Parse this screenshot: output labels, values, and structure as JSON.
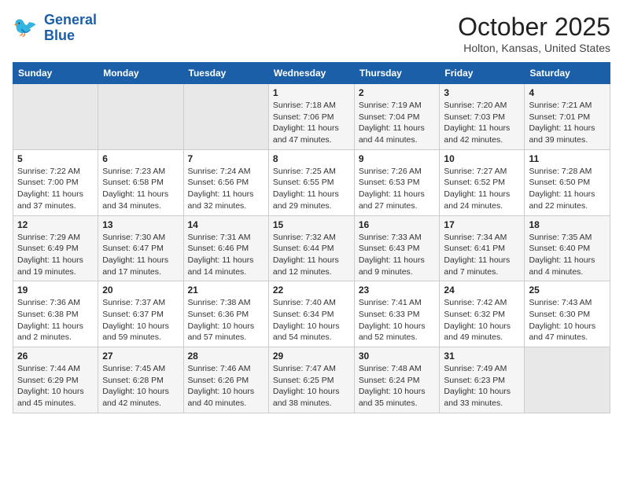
{
  "header": {
    "logo_line1": "General",
    "logo_line2": "Blue",
    "month": "October 2025",
    "location": "Holton, Kansas, United States"
  },
  "days_of_week": [
    "Sunday",
    "Monday",
    "Tuesday",
    "Wednesday",
    "Thursday",
    "Friday",
    "Saturday"
  ],
  "weeks": [
    [
      {
        "day": "",
        "sunrise": "",
        "sunset": "",
        "daylight": ""
      },
      {
        "day": "",
        "sunrise": "",
        "sunset": "",
        "daylight": ""
      },
      {
        "day": "",
        "sunrise": "",
        "sunset": "",
        "daylight": ""
      },
      {
        "day": "1",
        "sunrise": "Sunrise: 7:18 AM",
        "sunset": "Sunset: 7:06 PM",
        "daylight": "Daylight: 11 hours and 47 minutes."
      },
      {
        "day": "2",
        "sunrise": "Sunrise: 7:19 AM",
        "sunset": "Sunset: 7:04 PM",
        "daylight": "Daylight: 11 hours and 44 minutes."
      },
      {
        "day": "3",
        "sunrise": "Sunrise: 7:20 AM",
        "sunset": "Sunset: 7:03 PM",
        "daylight": "Daylight: 11 hours and 42 minutes."
      },
      {
        "day": "4",
        "sunrise": "Sunrise: 7:21 AM",
        "sunset": "Sunset: 7:01 PM",
        "daylight": "Daylight: 11 hours and 39 minutes."
      }
    ],
    [
      {
        "day": "5",
        "sunrise": "Sunrise: 7:22 AM",
        "sunset": "Sunset: 7:00 PM",
        "daylight": "Daylight: 11 hours and 37 minutes."
      },
      {
        "day": "6",
        "sunrise": "Sunrise: 7:23 AM",
        "sunset": "Sunset: 6:58 PM",
        "daylight": "Daylight: 11 hours and 34 minutes."
      },
      {
        "day": "7",
        "sunrise": "Sunrise: 7:24 AM",
        "sunset": "Sunset: 6:56 PM",
        "daylight": "Daylight: 11 hours and 32 minutes."
      },
      {
        "day": "8",
        "sunrise": "Sunrise: 7:25 AM",
        "sunset": "Sunset: 6:55 PM",
        "daylight": "Daylight: 11 hours and 29 minutes."
      },
      {
        "day": "9",
        "sunrise": "Sunrise: 7:26 AM",
        "sunset": "Sunset: 6:53 PM",
        "daylight": "Daylight: 11 hours and 27 minutes."
      },
      {
        "day": "10",
        "sunrise": "Sunrise: 7:27 AM",
        "sunset": "Sunset: 6:52 PM",
        "daylight": "Daylight: 11 hours and 24 minutes."
      },
      {
        "day": "11",
        "sunrise": "Sunrise: 7:28 AM",
        "sunset": "Sunset: 6:50 PM",
        "daylight": "Daylight: 11 hours and 22 minutes."
      }
    ],
    [
      {
        "day": "12",
        "sunrise": "Sunrise: 7:29 AM",
        "sunset": "Sunset: 6:49 PM",
        "daylight": "Daylight: 11 hours and 19 minutes."
      },
      {
        "day": "13",
        "sunrise": "Sunrise: 7:30 AM",
        "sunset": "Sunset: 6:47 PM",
        "daylight": "Daylight: 11 hours and 17 minutes."
      },
      {
        "day": "14",
        "sunrise": "Sunrise: 7:31 AM",
        "sunset": "Sunset: 6:46 PM",
        "daylight": "Daylight: 11 hours and 14 minutes."
      },
      {
        "day": "15",
        "sunrise": "Sunrise: 7:32 AM",
        "sunset": "Sunset: 6:44 PM",
        "daylight": "Daylight: 11 hours and 12 minutes."
      },
      {
        "day": "16",
        "sunrise": "Sunrise: 7:33 AM",
        "sunset": "Sunset: 6:43 PM",
        "daylight": "Daylight: 11 hours and 9 minutes."
      },
      {
        "day": "17",
        "sunrise": "Sunrise: 7:34 AM",
        "sunset": "Sunset: 6:41 PM",
        "daylight": "Daylight: 11 hours and 7 minutes."
      },
      {
        "day": "18",
        "sunrise": "Sunrise: 7:35 AM",
        "sunset": "Sunset: 6:40 PM",
        "daylight": "Daylight: 11 hours and 4 minutes."
      }
    ],
    [
      {
        "day": "19",
        "sunrise": "Sunrise: 7:36 AM",
        "sunset": "Sunset: 6:38 PM",
        "daylight": "Daylight: 11 hours and 2 minutes."
      },
      {
        "day": "20",
        "sunrise": "Sunrise: 7:37 AM",
        "sunset": "Sunset: 6:37 PM",
        "daylight": "Daylight: 10 hours and 59 minutes."
      },
      {
        "day": "21",
        "sunrise": "Sunrise: 7:38 AM",
        "sunset": "Sunset: 6:36 PM",
        "daylight": "Daylight: 10 hours and 57 minutes."
      },
      {
        "day": "22",
        "sunrise": "Sunrise: 7:40 AM",
        "sunset": "Sunset: 6:34 PM",
        "daylight": "Daylight: 10 hours and 54 minutes."
      },
      {
        "day": "23",
        "sunrise": "Sunrise: 7:41 AM",
        "sunset": "Sunset: 6:33 PM",
        "daylight": "Daylight: 10 hours and 52 minutes."
      },
      {
        "day": "24",
        "sunrise": "Sunrise: 7:42 AM",
        "sunset": "Sunset: 6:32 PM",
        "daylight": "Daylight: 10 hours and 49 minutes."
      },
      {
        "day": "25",
        "sunrise": "Sunrise: 7:43 AM",
        "sunset": "Sunset: 6:30 PM",
        "daylight": "Daylight: 10 hours and 47 minutes."
      }
    ],
    [
      {
        "day": "26",
        "sunrise": "Sunrise: 7:44 AM",
        "sunset": "Sunset: 6:29 PM",
        "daylight": "Daylight: 10 hours and 45 minutes."
      },
      {
        "day": "27",
        "sunrise": "Sunrise: 7:45 AM",
        "sunset": "Sunset: 6:28 PM",
        "daylight": "Daylight: 10 hours and 42 minutes."
      },
      {
        "day": "28",
        "sunrise": "Sunrise: 7:46 AM",
        "sunset": "Sunset: 6:26 PM",
        "daylight": "Daylight: 10 hours and 40 minutes."
      },
      {
        "day": "29",
        "sunrise": "Sunrise: 7:47 AM",
        "sunset": "Sunset: 6:25 PM",
        "daylight": "Daylight: 10 hours and 38 minutes."
      },
      {
        "day": "30",
        "sunrise": "Sunrise: 7:48 AM",
        "sunset": "Sunset: 6:24 PM",
        "daylight": "Daylight: 10 hours and 35 minutes."
      },
      {
        "day": "31",
        "sunrise": "Sunrise: 7:49 AM",
        "sunset": "Sunset: 6:23 PM",
        "daylight": "Daylight: 10 hours and 33 minutes."
      },
      {
        "day": "",
        "sunrise": "",
        "sunset": "",
        "daylight": ""
      }
    ]
  ]
}
